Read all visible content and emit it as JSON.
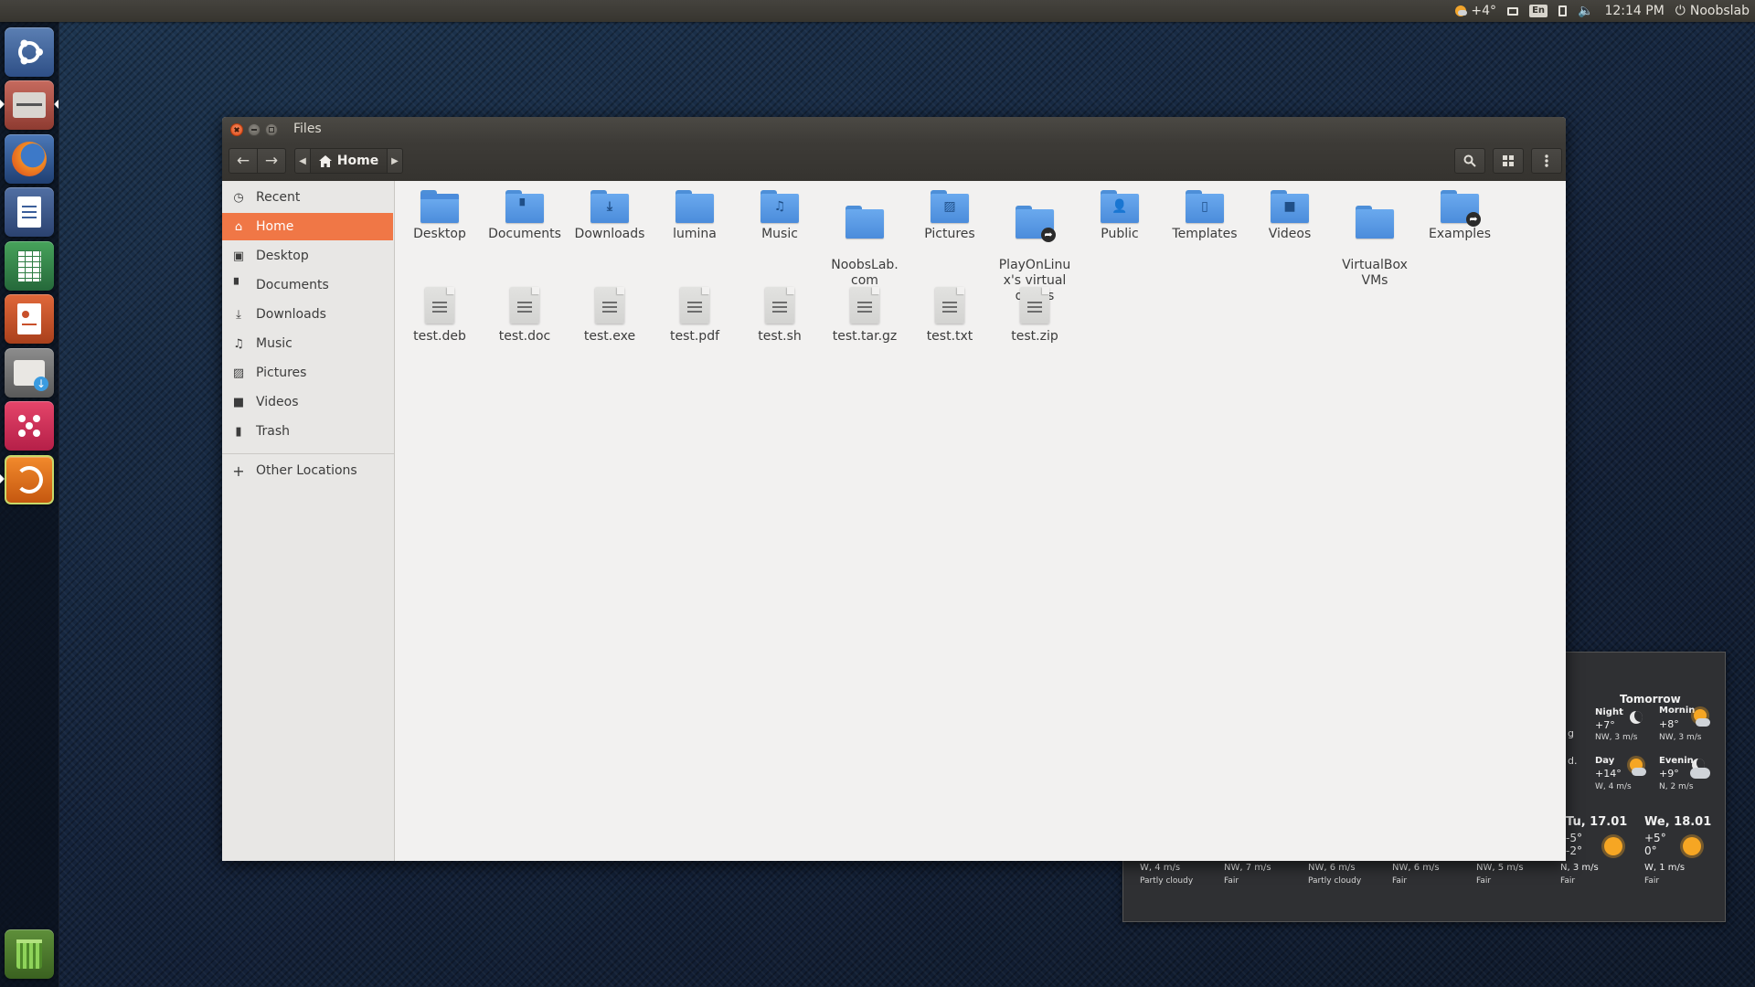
{
  "top_panel": {
    "weather_temp": "+4°",
    "keyboard_layout": "En",
    "time": "12:14 PM",
    "user": "Noobslab"
  },
  "launcher": {
    "items": [
      {
        "name": "ubuntu-dash"
      },
      {
        "name": "files"
      },
      {
        "name": "firefox"
      },
      {
        "name": "libreoffice-writer"
      },
      {
        "name": "libreoffice-calc"
      },
      {
        "name": "libreoffice-impress"
      },
      {
        "name": "software-center"
      },
      {
        "name": "unity-tweak"
      },
      {
        "name": "software-updater"
      },
      {
        "name": "trash"
      }
    ]
  },
  "window": {
    "title": "Files",
    "path_label": "Home"
  },
  "sidebar": {
    "items": [
      {
        "label": "Recent",
        "icon": "clock-icon"
      },
      {
        "label": "Home",
        "icon": "home-icon",
        "active": true
      },
      {
        "label": "Desktop",
        "icon": "desktop-icon"
      },
      {
        "label": "Documents",
        "icon": "document-icon"
      },
      {
        "label": "Downloads",
        "icon": "download-icon"
      },
      {
        "label": "Music",
        "icon": "music-icon"
      },
      {
        "label": "Pictures",
        "icon": "picture-icon"
      },
      {
        "label": "Videos",
        "icon": "video-icon"
      },
      {
        "label": "Trash",
        "icon": "trash-icon"
      }
    ],
    "other_locations": "Other Locations"
  },
  "folders": [
    {
      "label": "Desktop",
      "type": "desktop"
    },
    {
      "label": "Documents",
      "type": "documents"
    },
    {
      "label": "Downloads",
      "type": "downloads"
    },
    {
      "label": "lumina",
      "type": "plain"
    },
    {
      "label": "Music",
      "type": "music"
    },
    {
      "label": "NoobsLab.\ncom",
      "type": "plain"
    },
    {
      "label": "Pictures",
      "type": "pictures"
    },
    {
      "label": "PlayOnLinu\nx's virtual\ndrives",
      "type": "link"
    },
    {
      "label": "Public",
      "type": "public"
    },
    {
      "label": "Templates",
      "type": "templates"
    },
    {
      "label": "Videos",
      "type": "videos"
    },
    {
      "label": "VirtualBox\nVMs",
      "type": "plain"
    },
    {
      "label": "Examples",
      "type": "link"
    }
  ],
  "files": [
    {
      "label": "test.deb"
    },
    {
      "label": "test.doc"
    },
    {
      "label": "test.exe"
    },
    {
      "label": "test.pdf"
    },
    {
      "label": "test.sh"
    },
    {
      "label": "test.tar.gz"
    },
    {
      "label": "test.txt"
    },
    {
      "label": "test.zip"
    }
  ],
  "weather": {
    "tomorrow_label": "Tomorrow",
    "night": {
      "label": "Night",
      "temp": "+7°",
      "wind": "NW, 3 m/s"
    },
    "morning": {
      "label": "Mornin",
      "temp": "+8°",
      "wind": "NW, 3 m/s"
    },
    "day": {
      "label": "Day",
      "temp": "+14°",
      "wind": "W, 4 m/s"
    },
    "evening": {
      "label": "Evenin",
      "temp": "+9°",
      "wind": "N, 2 m/s"
    },
    "edge_labels": [
      "g",
      "d."
    ],
    "days": [
      {
        "name": "Tu, 17.01",
        "high": "-5°",
        "low": "-2°"
      },
      {
        "name": "We, 18.01",
        "high": "+5°",
        "low": "0°"
      }
    ],
    "forecast_row": [
      {
        "wind": "W, 4 m/s",
        "cond": "Partly cloudy"
      },
      {
        "wind": "NW, 7 m/s",
        "cond": "Fair"
      },
      {
        "wind": "NW, 6 m/s",
        "cond": "Partly cloudy"
      },
      {
        "wind": "NW, 6 m/s",
        "cond": "Fair"
      },
      {
        "wind": "NW, 5 m/s",
        "cond": "Fair"
      },
      {
        "wind": "N, 3 m/s",
        "cond": "Fair"
      },
      {
        "wind": "W, 1 m/s",
        "cond": "Fair"
      }
    ]
  }
}
